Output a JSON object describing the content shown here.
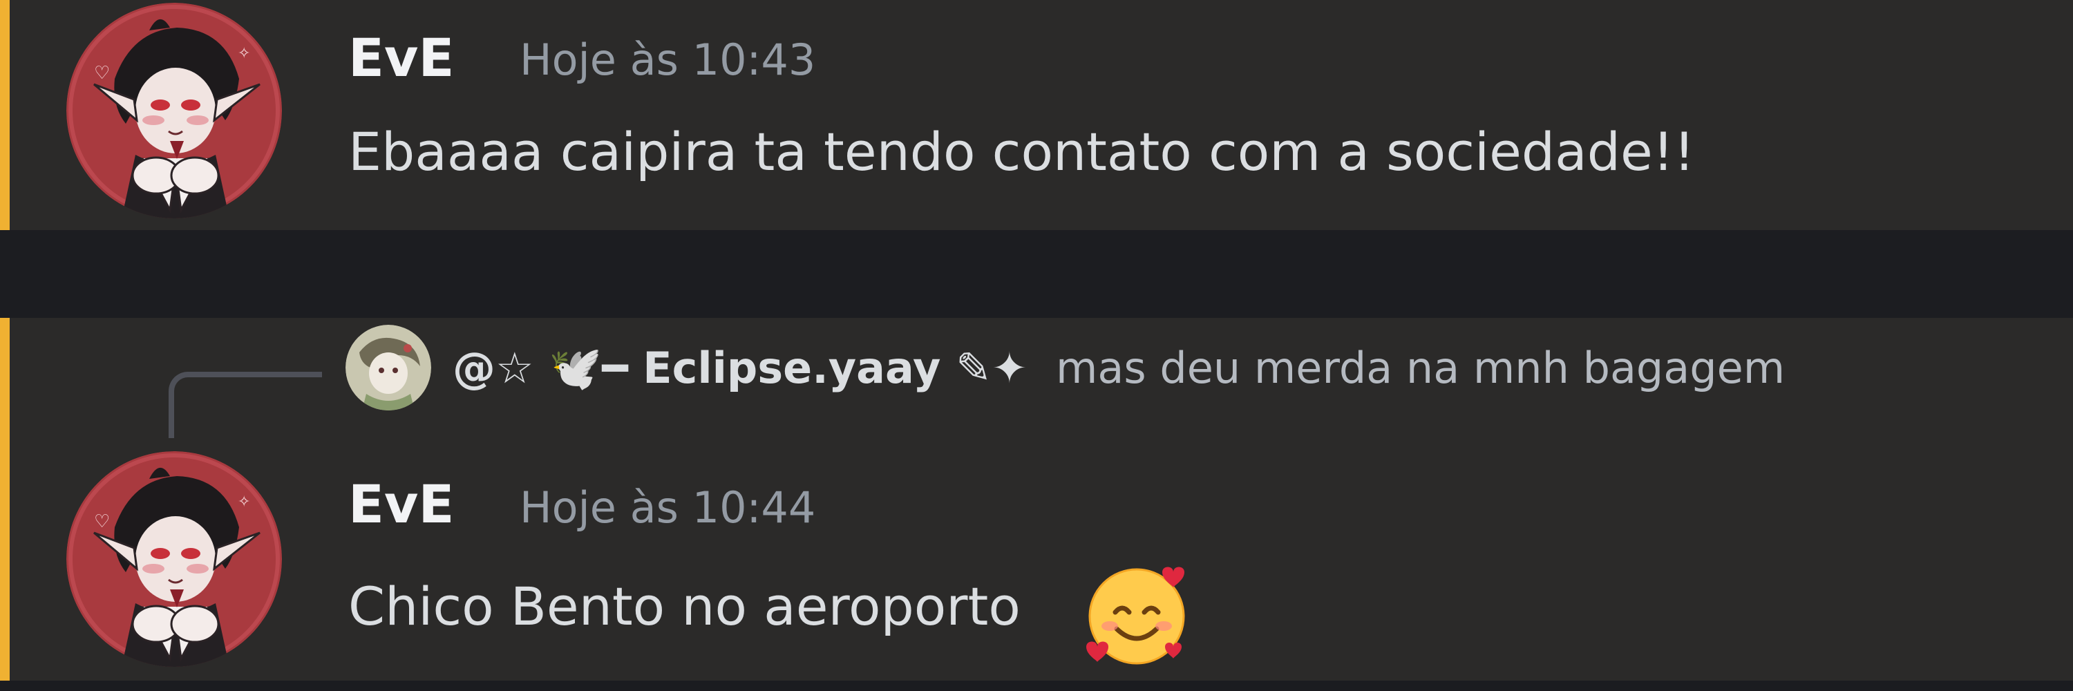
{
  "colors": {
    "background": "#2b2a29",
    "separator": "#1c1d21",
    "highlight": "#f0b132",
    "username": "#f2f3f5",
    "timestamp": "#949ba4",
    "message_text": "#dbdee1",
    "reply_text": "#b5bac1"
  },
  "messages": [
    {
      "author": "EvE",
      "timestamp": "Hoje às 10:43",
      "content": "Ebaaaa caipira ta tendo contato com a sociedade!!",
      "avatar_icon": "vampire-character-avatar"
    },
    {
      "author": "EvE",
      "timestamp": "Hoje às 10:44",
      "content": "Chico Bento no aeroporto",
      "avatar_icon": "vampire-character-avatar",
      "emoji_icon": "smiling-face-with-hearts-emoji",
      "reply": {
        "author": "@☆ 🕊️━ Eclipse.yaay ✎✦",
        "content": "mas deu merda na mnh bagagem",
        "avatar_icon": "reply-user-avatar"
      }
    }
  ]
}
